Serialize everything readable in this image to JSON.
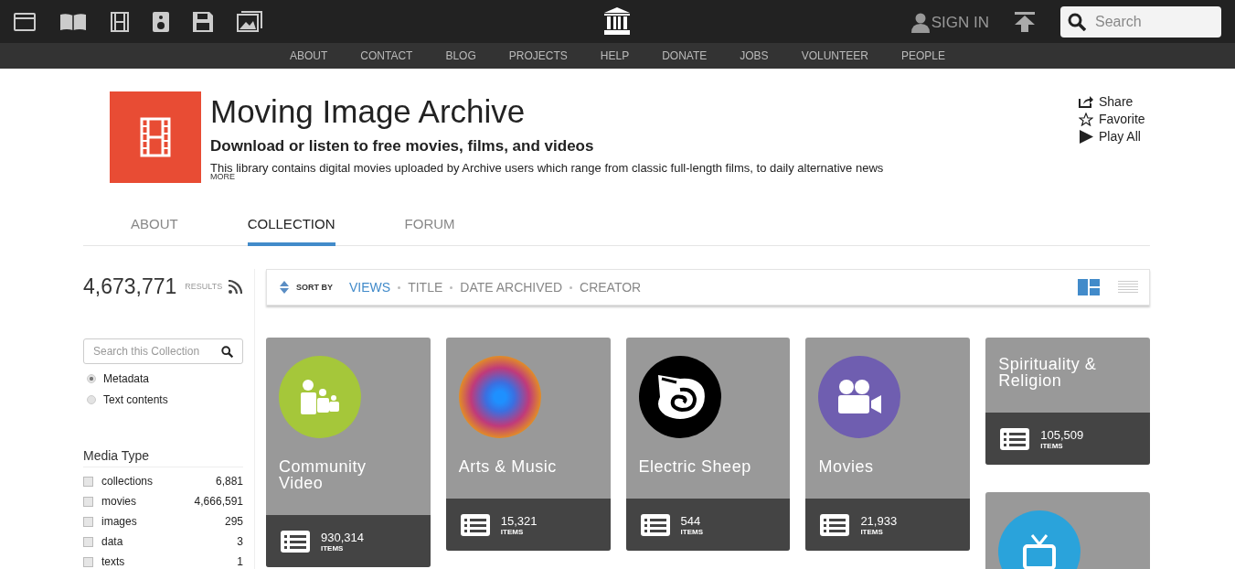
{
  "top_bar": {
    "sign_in": "SIGN IN",
    "search": {
      "placeholder": "Search"
    }
  },
  "nav": [
    "ABOUT",
    "CONTACT",
    "BLOG",
    "PROJECTS",
    "HELP",
    "DONATE",
    "JOBS",
    "VOLUNTEER",
    "PEOPLE"
  ],
  "header": {
    "title": "Moving Image Archive",
    "subtitle": "Download or listen to free movies, films, and videos",
    "description": "This library contains digital movies uploaded by Archive users which range from classic full-length films, to daily alternative news",
    "more": "MORE",
    "actions": [
      "Share",
      "Favorite",
      "Play All"
    ]
  },
  "tabs": [
    {
      "label": "ABOUT",
      "selected": false
    },
    {
      "label": "COLLECTION",
      "selected": true
    },
    {
      "label": "FORUM",
      "selected": false
    }
  ],
  "results": {
    "count": "4,673,771",
    "label": "RESULTS"
  },
  "sort": {
    "label": "SORT BY",
    "options": [
      {
        "label": "VIEWS",
        "selected": true
      },
      {
        "label": "TITLE",
        "selected": false
      },
      {
        "label": "DATE ARCHIVED",
        "selected": false
      },
      {
        "label": "CREATOR",
        "selected": false
      }
    ],
    "views": [
      {
        "selected": true
      },
      {
        "selected": false
      }
    ]
  },
  "sidebar": {
    "search": {
      "placeholder": "Search this Collection"
    },
    "radios": [
      {
        "label": "Metadata",
        "selected": true
      },
      {
        "label": "Text contents",
        "selected": false
      }
    ],
    "facet_title": "Media Type",
    "facets": [
      {
        "name": "collections",
        "count": "6,881",
        "checked": false
      },
      {
        "name": "movies",
        "count": "4,666,591",
        "checked": false
      },
      {
        "name": "images",
        "count": "295",
        "checked": false
      },
      {
        "name": "data",
        "count": "3",
        "checked": false
      },
      {
        "name": "texts",
        "count": "1",
        "checked": false
      }
    ]
  },
  "columns": [
    [
      {
        "kind": "icon",
        "color": "#a5c73a",
        "title": "Community Video",
        "count": "930,314",
        "count_label": "ITEMS"
      }
    ],
    [
      {
        "kind": "photo",
        "title": "Arts & Music",
        "count": "15,321",
        "count_label": "ITEMS"
      }
    ],
    [
      {
        "kind": "icon",
        "color": "#000000",
        "title": "Electric Sheep",
        "count": "544",
        "count_label": "ITEMS"
      }
    ],
    [
      {
        "kind": "icon",
        "color": "#6f5eb0",
        "title": "Movies",
        "count": "21,933",
        "count_label": "ITEMS"
      }
    ],
    [
      {
        "kind": "text",
        "title": "Spirituality & Religion",
        "count": "105,509",
        "count_label": "ITEMS"
      },
      {
        "kind": "icon",
        "color": "#2aa3db"
      }
    ]
  ]
}
